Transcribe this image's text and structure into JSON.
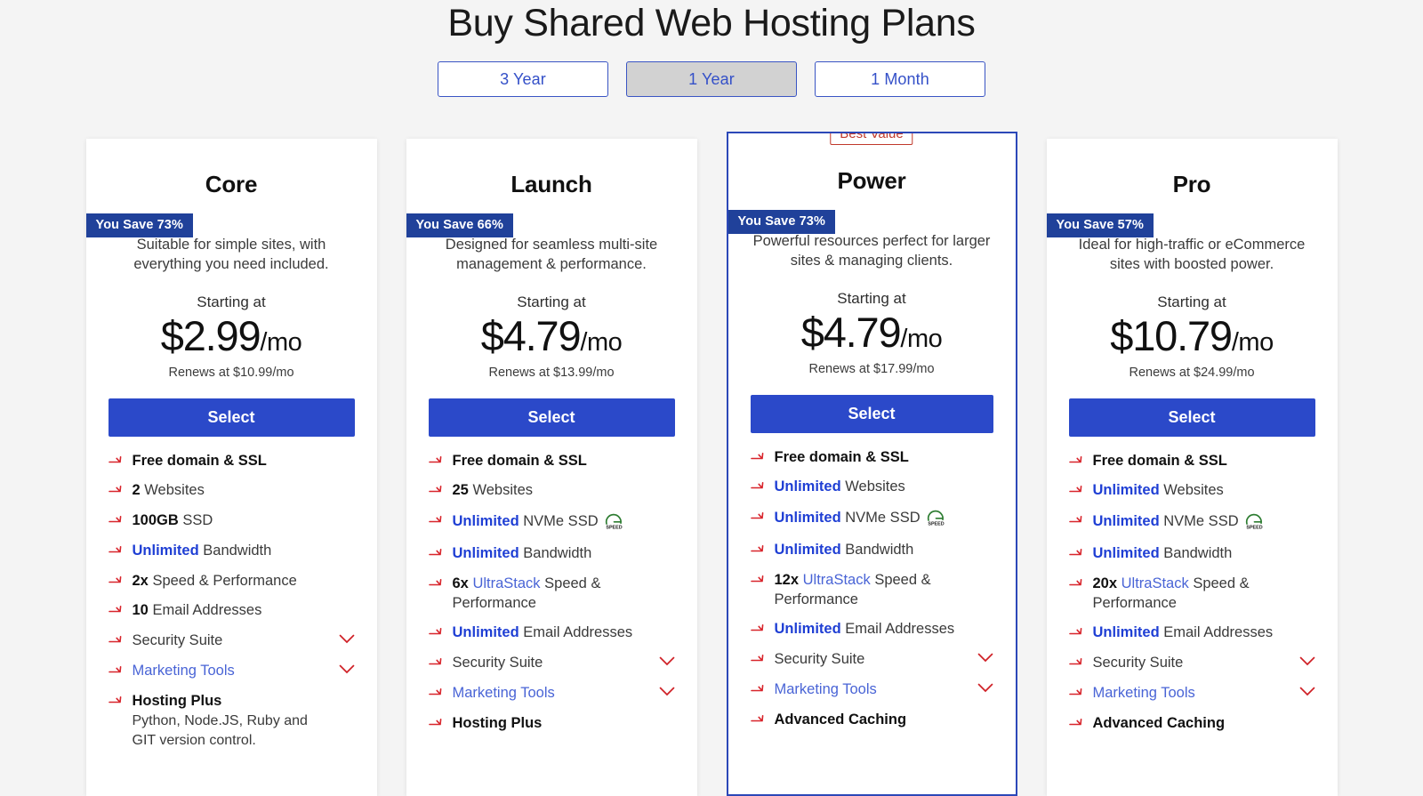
{
  "header": {
    "title": "Buy Shared Web Hosting Plans"
  },
  "term_toggle": {
    "options": [
      {
        "label": "3 Year",
        "selected": false
      },
      {
        "label": "1 Year",
        "selected": true
      },
      {
        "label": "1 Month",
        "selected": false
      }
    ]
  },
  "colors": {
    "accent_blue": "#2b49c9",
    "badge_blue": "#20419a",
    "arrow_red": "#d8242b",
    "best_value_red": "#c0392b",
    "page_bg": "#f4f4f4",
    "speed_green": "#2e7d32"
  },
  "labels": {
    "starting_at": "Starting at",
    "select": "Select",
    "best_value": "Best Value"
  },
  "plans": [
    {
      "name": "Core",
      "save_badge": "You Save 73%",
      "description": "Suitable for simple sites, with everything you need included.",
      "starting_at": "Starting at",
      "price_amount": "$2.99",
      "price_per": "/mo",
      "renews": "Renews at $10.99/mo",
      "select_label": "Select",
      "featured": false,
      "features": [
        {
          "bold": "Free domain & SSL",
          "rest": "",
          "style": "bold",
          "chevron": false
        },
        {
          "bold": "2",
          "rest": " Websites",
          "style": "bold",
          "chevron": false
        },
        {
          "bold": "100GB",
          "rest": " SSD",
          "style": "bold",
          "chevron": false
        },
        {
          "bold": "Unlimited",
          "rest": " Bandwidth",
          "style": "highlight",
          "chevron": false
        },
        {
          "bold": "2x",
          "rest": " Speed & Performance",
          "style": "bold",
          "chevron": false
        },
        {
          "bold": "10",
          "rest": " Email Addresses",
          "style": "bold",
          "chevron": false
        },
        {
          "bold": "",
          "rest": "Security Suite",
          "style": "plain",
          "chevron": true
        },
        {
          "bold": "",
          "rest": "Marketing Tools",
          "style": "link",
          "chevron": true
        },
        {
          "bold": "Hosting Plus",
          "rest": "",
          "style": "bold",
          "chevron": false,
          "sub": "Python,  Node.JS,   Ruby and GIT version control."
        }
      ]
    },
    {
      "name": "Launch",
      "save_badge": "You Save 66%",
      "description": "Designed for seamless multi-site management & performance.",
      "starting_at": "Starting at",
      "price_amount": "$4.79",
      "price_per": "/mo",
      "renews": "Renews at $13.99/mo",
      "select_label": "Select",
      "featured": false,
      "features": [
        {
          "bold": "Free domain & SSL",
          "rest": "",
          "style": "bold",
          "chevron": false
        },
        {
          "bold": "25",
          "rest": " Websites",
          "style": "bold",
          "chevron": false
        },
        {
          "bold": "Unlimited",
          "rest": " NVMe SSD",
          "style": "highlight",
          "chevron": false,
          "speed_icon": true
        },
        {
          "bold": "Unlimited",
          "rest": " Bandwidth",
          "style": "highlight",
          "chevron": false
        },
        {
          "bold": "6x",
          "rest": " UltraStack Speed & Performance",
          "style": "ultrastack",
          "chevron": false
        },
        {
          "bold": "Unlimited",
          "rest": " Email Addresses",
          "style": "highlight",
          "chevron": false
        },
        {
          "bold": "",
          "rest": "Security Suite",
          "style": "plain",
          "chevron": true
        },
        {
          "bold": "",
          "rest": "Marketing Tools",
          "style": "link",
          "chevron": true
        },
        {
          "bold": "Hosting Plus",
          "rest": "",
          "style": "bold",
          "chevron": false
        }
      ]
    },
    {
      "name": "Power",
      "save_badge": "You Save 73%",
      "description": "Powerful resources perfect for larger sites & managing clients.",
      "starting_at": "Starting at",
      "price_amount": "$4.79",
      "price_per": "/mo",
      "renews": "Renews at $17.99/mo",
      "select_label": "Select",
      "featured": true,
      "badge": "Best Value",
      "features": [
        {
          "bold": "Free domain & SSL",
          "rest": "",
          "style": "bold",
          "chevron": false
        },
        {
          "bold": "Unlimited",
          "rest": " Websites",
          "style": "highlight",
          "chevron": false
        },
        {
          "bold": "Unlimited",
          "rest": " NVMe SSD",
          "style": "highlight",
          "chevron": false,
          "speed_icon": true
        },
        {
          "bold": "Unlimited",
          "rest": " Bandwidth",
          "style": "highlight",
          "chevron": false
        },
        {
          "bold": "12x",
          "rest": " UltraStack Speed & Performance",
          "style": "ultrastack",
          "chevron": false
        },
        {
          "bold": "Unlimited",
          "rest": " Email Addresses",
          "style": "highlight",
          "chevron": false
        },
        {
          "bold": "",
          "rest": "Security Suite",
          "style": "plain",
          "chevron": true
        },
        {
          "bold": "",
          "rest": "Marketing Tools",
          "style": "link",
          "chevron": true
        },
        {
          "bold": "Advanced Caching",
          "rest": "",
          "style": "bold",
          "chevron": false
        }
      ]
    },
    {
      "name": "Pro",
      "save_badge": "You Save 57%",
      "description": "Ideal for high-traffic or eCommerce sites with boosted power.",
      "starting_at": "Starting at",
      "price_amount": "$10.79",
      "price_per": "/mo",
      "renews": "Renews at $24.99/mo",
      "select_label": "Select",
      "featured": false,
      "features": [
        {
          "bold": "Free domain & SSL",
          "rest": "",
          "style": "bold",
          "chevron": false
        },
        {
          "bold": "Unlimited",
          "rest": " Websites",
          "style": "highlight",
          "chevron": false
        },
        {
          "bold": "Unlimited",
          "rest": " NVMe SSD",
          "style": "highlight",
          "chevron": false,
          "speed_icon": true
        },
        {
          "bold": "Unlimited",
          "rest": " Bandwidth",
          "style": "highlight",
          "chevron": false
        },
        {
          "bold": "20x",
          "rest": " UltraStack Speed & Performance",
          "style": "ultrastack",
          "chevron": false
        },
        {
          "bold": "Unlimited",
          "rest": " Email Addresses",
          "style": "highlight",
          "chevron": false
        },
        {
          "bold": "",
          "rest": "Security Suite",
          "style": "plain",
          "chevron": true
        },
        {
          "bold": "",
          "rest": "Marketing Tools",
          "style": "link",
          "chevron": true
        },
        {
          "bold": "Advanced Caching",
          "rest": "",
          "style": "bold",
          "chevron": false
        }
      ]
    }
  ],
  "icons": {
    "arrow": "arrow-right-icon",
    "chevron": "chevron-down-icon",
    "speed": "speed-badge-icon"
  }
}
